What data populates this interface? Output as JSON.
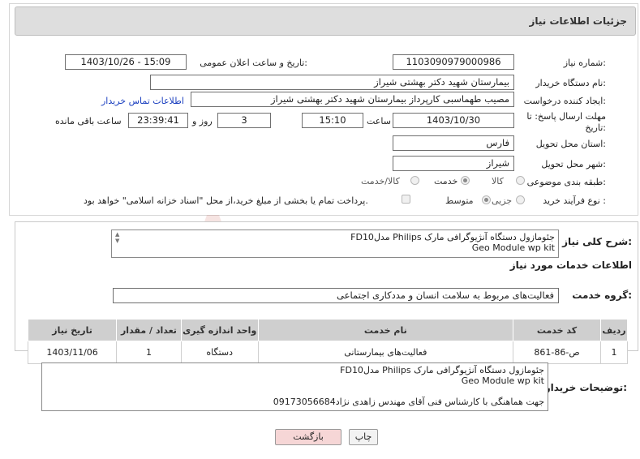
{
  "header": {
    "title": "جزئیات اطلاعات نیاز"
  },
  "form": {
    "need_number_label": "شماره نیاز:",
    "need_number": "1103090979000986",
    "announce_label": "تاریخ و ساعت اعلان عمومی:",
    "announce_value": "1403/10/26 - 15:09",
    "buyer_label": "نام دستگاه خریدار:",
    "buyer_value": "بیمارستان شهید دکتر بهشتی شیراز",
    "creator_label": "ایجاد کننده درخواست:",
    "creator_value": "مصیب طهماسبی کارپرداز بیمارستان شهید دکتر بهشتی شیراز",
    "contact_link": "اطلاعات تماس خریدار",
    "deadline_label_1": "مهلت ارسال پاسخ: تا",
    "deadline_label_2": "تاریخ:",
    "deadline_date": "1403/10/30",
    "time_label": "ساعت",
    "deadline_time": "15:10",
    "days_value": "3",
    "days_label": "روز و",
    "remaining_time": "23:39:41",
    "remaining_label": "ساعت باقی مانده",
    "province_label": "استان محل تحویل:",
    "province_value": "فارس",
    "city_label": "شهر محل تحویل:",
    "city_value": "شیراز",
    "category_label": "طبقه بندی موضوعی:",
    "category_options": [
      "کالا",
      "خدمت",
      "کالا/خدمت"
    ],
    "category_selected": "خدمت",
    "process_label": "نوع فرآیند خرید :",
    "process_options": [
      "جزیی",
      "متوسط"
    ],
    "process_selected": "متوسط",
    "payment_note": "پرداخت تمام یا بخشی از مبلغ خرید،از محل \"اسناد خزانه اسلامی\" خواهد بود."
  },
  "summary": {
    "label": "شرح کلی نیاز:",
    "line1": "جئومازول دستگاه آنژیوگرافی مارک Philips مدلFD10",
    "line2": "Geo Module wp kit"
  },
  "services": {
    "section_title": "اطلاعات خدمات مورد نیاز",
    "group_label": "گروه خدمت:",
    "group_value": "فعالیت‌های مربوط به سلامت انسان و مددکاری اجتماعی",
    "columns": [
      "ردیف",
      "کد خدمت",
      "نام خدمت",
      "واحد اندازه گیری",
      "تعداد / مقدار",
      "تاریخ نیاز"
    ],
    "rows": [
      {
        "row": "1",
        "code": "ص-86-861",
        "name": "فعالیت‌های بیمارستانی",
        "unit": "دستگاه",
        "qty": "1",
        "date": "1403/11/06"
      }
    ]
  },
  "buyer_notes": {
    "label": "توضیحات خریدار:",
    "line1": "جئومازول دستگاه آنژیوگرافی مارک Philips مدلFD10",
    "line2": "Geo Module wp kit",
    "line3": "جهت هماهنگی با کارشناس فنی آقای مهندس زاهدی نژاد09173056684"
  },
  "buttons": {
    "print": "چاپ",
    "back": "بازگشت"
  },
  "watermark": {
    "text": "AriaTender.neT"
  },
  "colors": {
    "link": "#1a3fbf",
    "header_bg": "#dedede",
    "back_bg": "#f6d6d6"
  }
}
